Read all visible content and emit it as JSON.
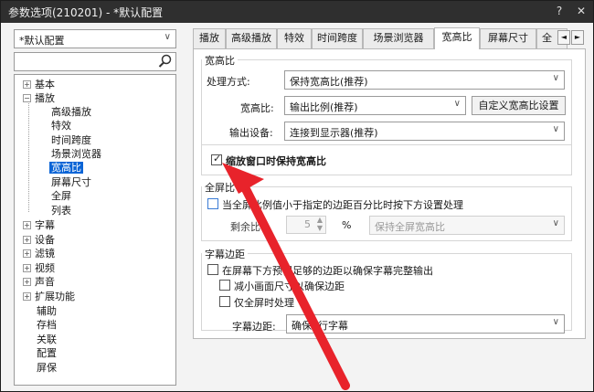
{
  "window": {
    "title": "参数选项(210201) - *默认配置",
    "help_icon": "?",
    "close_icon": "✕"
  },
  "sidebar": {
    "profile": "*默认配置",
    "search_placeholder": "",
    "tree": {
      "basic": "基本",
      "play": "播放",
      "play_children": [
        "高级播放",
        "特效",
        "时间跨度",
        "场景浏览器",
        "宽高比",
        "屏幕尺寸",
        "全屏",
        "列表"
      ],
      "rest": [
        "字幕",
        "设备",
        "滤镜",
        "视频",
        "声音",
        "扩展功能"
      ],
      "tail": [
        "辅助",
        "存档",
        "关联",
        "配置",
        "屏保"
      ]
    }
  },
  "tabs": [
    "播放",
    "高级播放",
    "特效",
    "时间跨度",
    "场景浏览器",
    "宽高比",
    "屏幕尺寸",
    "全"
  ],
  "tab_scroll": {
    "left": "◄",
    "right": "►"
  },
  "aspect_group": {
    "title": "宽高比",
    "method_label": "处理方式:",
    "method_value": "保持宽高比(推荐)",
    "ratio_label": "宽高比:",
    "ratio_value": "输出比例(推荐)",
    "custom_button": "自定义宽高比设置",
    "device_label": "输出设备:",
    "device_value": "连接到显示器(推荐)",
    "keep_checkbox": "缩放窗口时保持宽高比"
  },
  "fullscreen_group": {
    "title": "全屏比",
    "check_label": "当全屏比例值小于指定的边距百分比时按下方设置处理",
    "remain_label": "剩余比",
    "spin_value": "5",
    "unit": "%",
    "mode_value": "保持全屏宽高比"
  },
  "subtitle_group": {
    "title": "字幕边距",
    "check1": "在屏幕下方预留足够的边距以确保字幕完整输出",
    "check2": "减小画面尺寸以确保边距",
    "check3": "仅全屏时处理",
    "margin_label": "字幕边距:",
    "margin_value": "确保2行字幕"
  },
  "colors": {
    "arrow": "#e8232b",
    "selection": "#0a64d6",
    "titlebar": "#2f2f2f"
  }
}
